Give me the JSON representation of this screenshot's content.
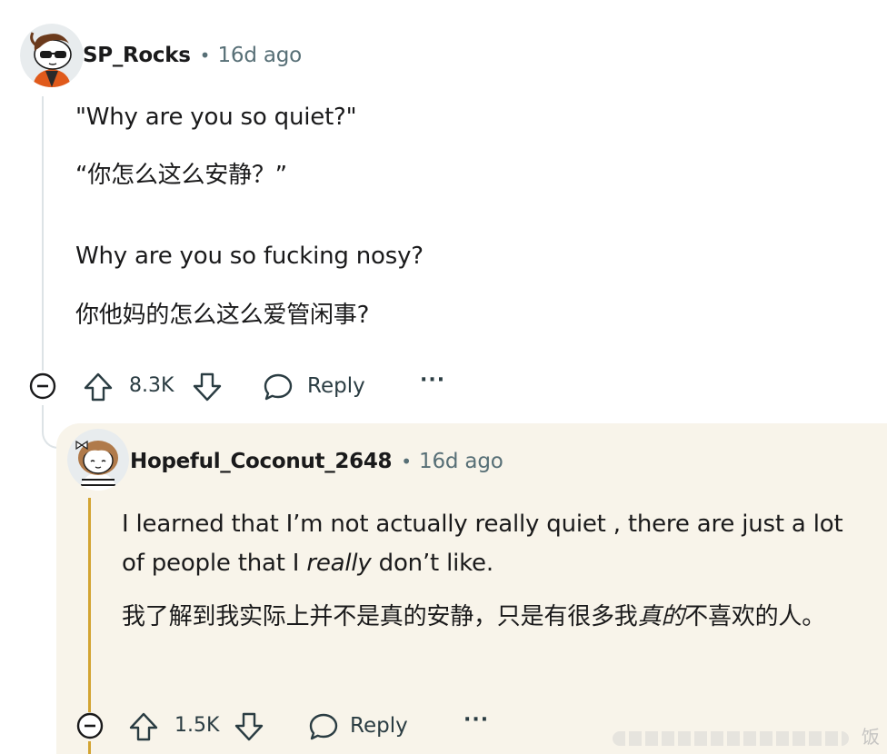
{
  "comment": {
    "username": "SP_Rocks",
    "separator": "•",
    "timestamp": "16d ago",
    "lines": [
      "\"Why are you so quiet?\"",
      "“你怎么这么安静？”",
      "Why are you so fucking nosy?",
      "你他妈的怎么这么爱管闲事?"
    ],
    "score": "8.3K",
    "reply_label": "Reply",
    "more_label": "···"
  },
  "reply": {
    "username": "Hopeful_Coconut_2648",
    "separator": "•",
    "timestamp": "16d ago",
    "p1_before": "I learned that I’m not actually really quiet , there are just a lot of people that I ",
    "p1_italic": "really",
    "p1_after": " don’t like.",
    "p2_before": "我了解到我实际上并不是真的安静，只是有很多我",
    "p2_italic": "真的",
    "p2_after": "不喜欢的人。",
    "score": "1.5K",
    "reply_label": "Reply",
    "more_label": "···"
  },
  "watermark": "饭",
  "colors": {
    "text": "#1a1a1b",
    "meta": "#576f76",
    "thread_line": "#dde3e6",
    "highlight_bg": "#f8f4ea",
    "highlight_line": "#d3a432"
  }
}
